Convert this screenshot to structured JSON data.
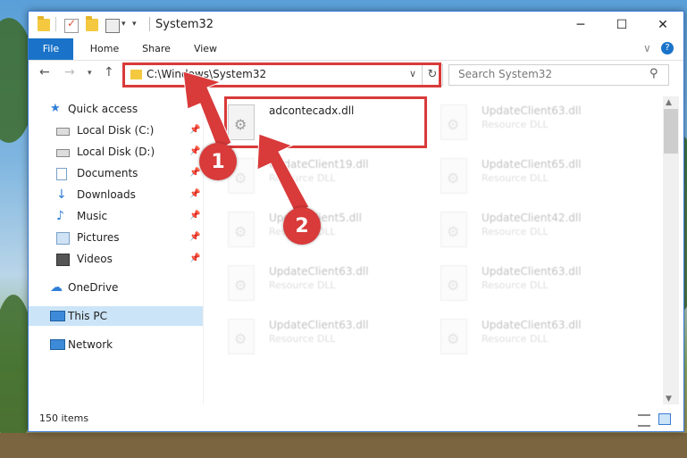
{
  "window": {
    "title": "System32",
    "minimize": "─",
    "maximize": "☐",
    "close": "✕"
  },
  "ribbon": {
    "tabs": [
      "File",
      "Home",
      "Share",
      "View"
    ],
    "help": "?",
    "expand": "∨"
  },
  "address": {
    "path": "C:\\Windows\\System32",
    "search_placeholder": "Search System32"
  },
  "nav": {
    "items": [
      {
        "label": "Quick access",
        "icon": "star-icon"
      },
      {
        "label": "Local Disk (C:)",
        "icon": "drive-icon",
        "pinned": true
      },
      {
        "label": "Local Disk (D:)",
        "icon": "drive-icon",
        "pinned": true
      },
      {
        "label": "Documents",
        "icon": "documents-icon",
        "pinned": true
      },
      {
        "label": "Downloads",
        "icon": "download-icon",
        "pinned": true
      },
      {
        "label": "Music",
        "icon": "music-icon",
        "pinned": true
      },
      {
        "label": "Pictures",
        "icon": "pictures-icon",
        "pinned": true
      },
      {
        "label": "Videos",
        "icon": "videos-icon",
        "pinned": true
      },
      {
        "label": "OneDrive",
        "icon": "cloud-icon"
      },
      {
        "label": "This PC",
        "icon": "computer-icon",
        "selected": true
      },
      {
        "label": "Network",
        "icon": "network-icon"
      }
    ]
  },
  "files": {
    "highlighted": {
      "name": "adcontecadx.dll"
    },
    "faded": [
      {
        "name": "UpdateClient63.dll",
        "type": "Resource DLL"
      },
      {
        "name": "UpdateClient19.dll",
        "type": "Resource DLL"
      },
      {
        "name": "UpdateClient65.dll",
        "type": "Resource DLL"
      },
      {
        "name": "UpdateClient5.dll",
        "type": "Resource DLL"
      },
      {
        "name": "UpdateClient42.dll",
        "type": "Resource DLL"
      },
      {
        "name": "UpdateClient63.dll",
        "type": "Resource DLL"
      },
      {
        "name": "UpdateClient63.dll",
        "type": "Resource DLL"
      },
      {
        "name": "UpdateClient63.dll",
        "type": "Resource DLL"
      },
      {
        "name": "UpdateClient63.dll",
        "type": "Resource DLL"
      }
    ]
  },
  "status": {
    "item_count": "150 items"
  },
  "annotations": {
    "marker1": "1",
    "marker2": "2",
    "color": "#d93a3a"
  }
}
